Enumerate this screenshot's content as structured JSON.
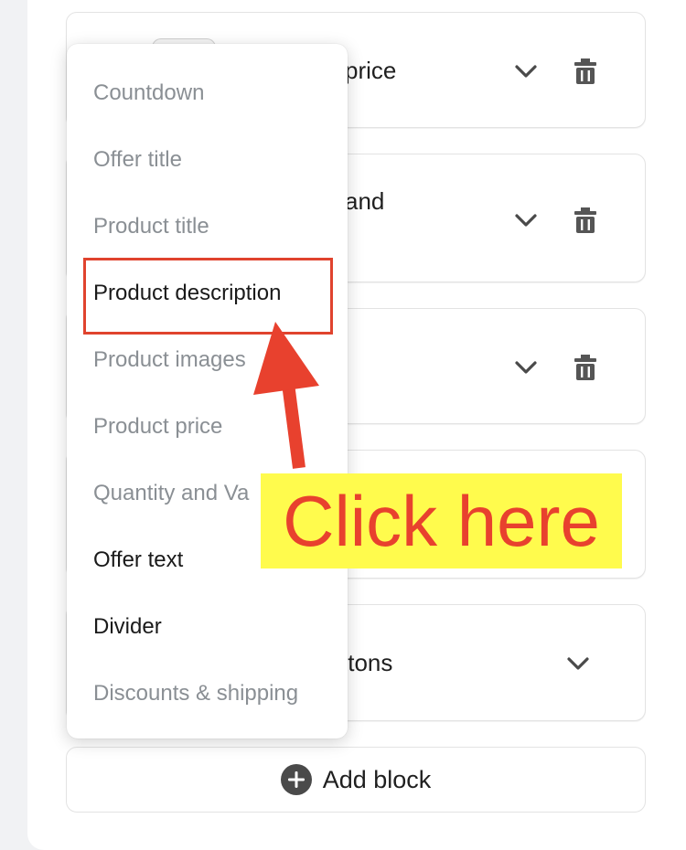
{
  "cards": [
    {
      "label_fragment": "price",
      "has_trash": true,
      "icons": [
        "chevron-down-icon",
        "trash-icon"
      ]
    },
    {
      "label_fragment": "and",
      "has_trash": true,
      "icons": [
        "chevron-down-icon",
        "trash-icon"
      ]
    },
    {
      "label_fragment": "",
      "has_trash": true,
      "icons": [
        "chevron-down-icon",
        "trash-icon"
      ]
    },
    {
      "label_fragment": "",
      "has_trash": false,
      "icons": []
    },
    {
      "label_fragment": "ttons",
      "has_trash": false,
      "icons": [
        "chevron-down-icon"
      ]
    }
  ],
  "add_block": {
    "label": "Add block",
    "icon": "plus-circle-icon"
  },
  "menu": {
    "items": [
      {
        "label": "Countdown",
        "state": "disabled"
      },
      {
        "label": "Offer title",
        "state": "disabled"
      },
      {
        "label": "Product title",
        "state": "disabled"
      },
      {
        "label": "Product description",
        "state": "enabled"
      },
      {
        "label": "Product images",
        "state": "disabled"
      },
      {
        "label": "Product price",
        "state": "disabled"
      },
      {
        "label": "Quantity and Va",
        "state": "disabled"
      },
      {
        "label": "Offer text",
        "state": "enabled"
      },
      {
        "label": "Divider",
        "state": "enabled"
      },
      {
        "label": "Discounts & shipping",
        "state": "disabled"
      }
    ]
  },
  "annotation": {
    "text": "Click here",
    "color": "#e8412e",
    "background": "#fffb4d",
    "target": "Product description"
  },
  "colors": {
    "muted_text": "#8a8f94",
    "dark_text": "#1a1a1a",
    "annotation_red": "#e0432e"
  }
}
